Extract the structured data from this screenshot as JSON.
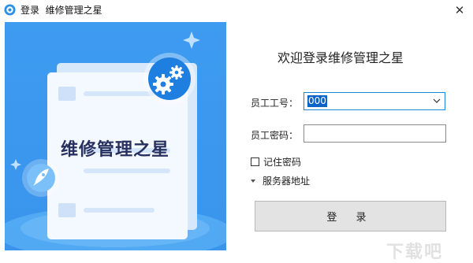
{
  "window": {
    "title": "登录  维修管理之星",
    "close_glyph": "✕"
  },
  "hero": {
    "title": "维修管理之星",
    "colors": {
      "background": "#3f9ff2",
      "card": "#f4f8ff",
      "badge": "#1f7fe0"
    }
  },
  "form": {
    "welcome": "欢迎登录维修管理之星",
    "employee_id_label": "员工工号：",
    "employee_id_value": "000",
    "password_label": "员工密码：",
    "password_value": "",
    "remember_label": "记住密码",
    "remember_checked": false,
    "server_label": "服务器地址",
    "login_label": "登 录"
  },
  "watermark": {
    "text": "下载吧"
  },
  "icons": [
    "app-logo-icon",
    "close-icon",
    "gear-icon",
    "rocket-icon",
    "sparkle-icon",
    "chevron-down-icon",
    "triangle-down-icon"
  ]
}
